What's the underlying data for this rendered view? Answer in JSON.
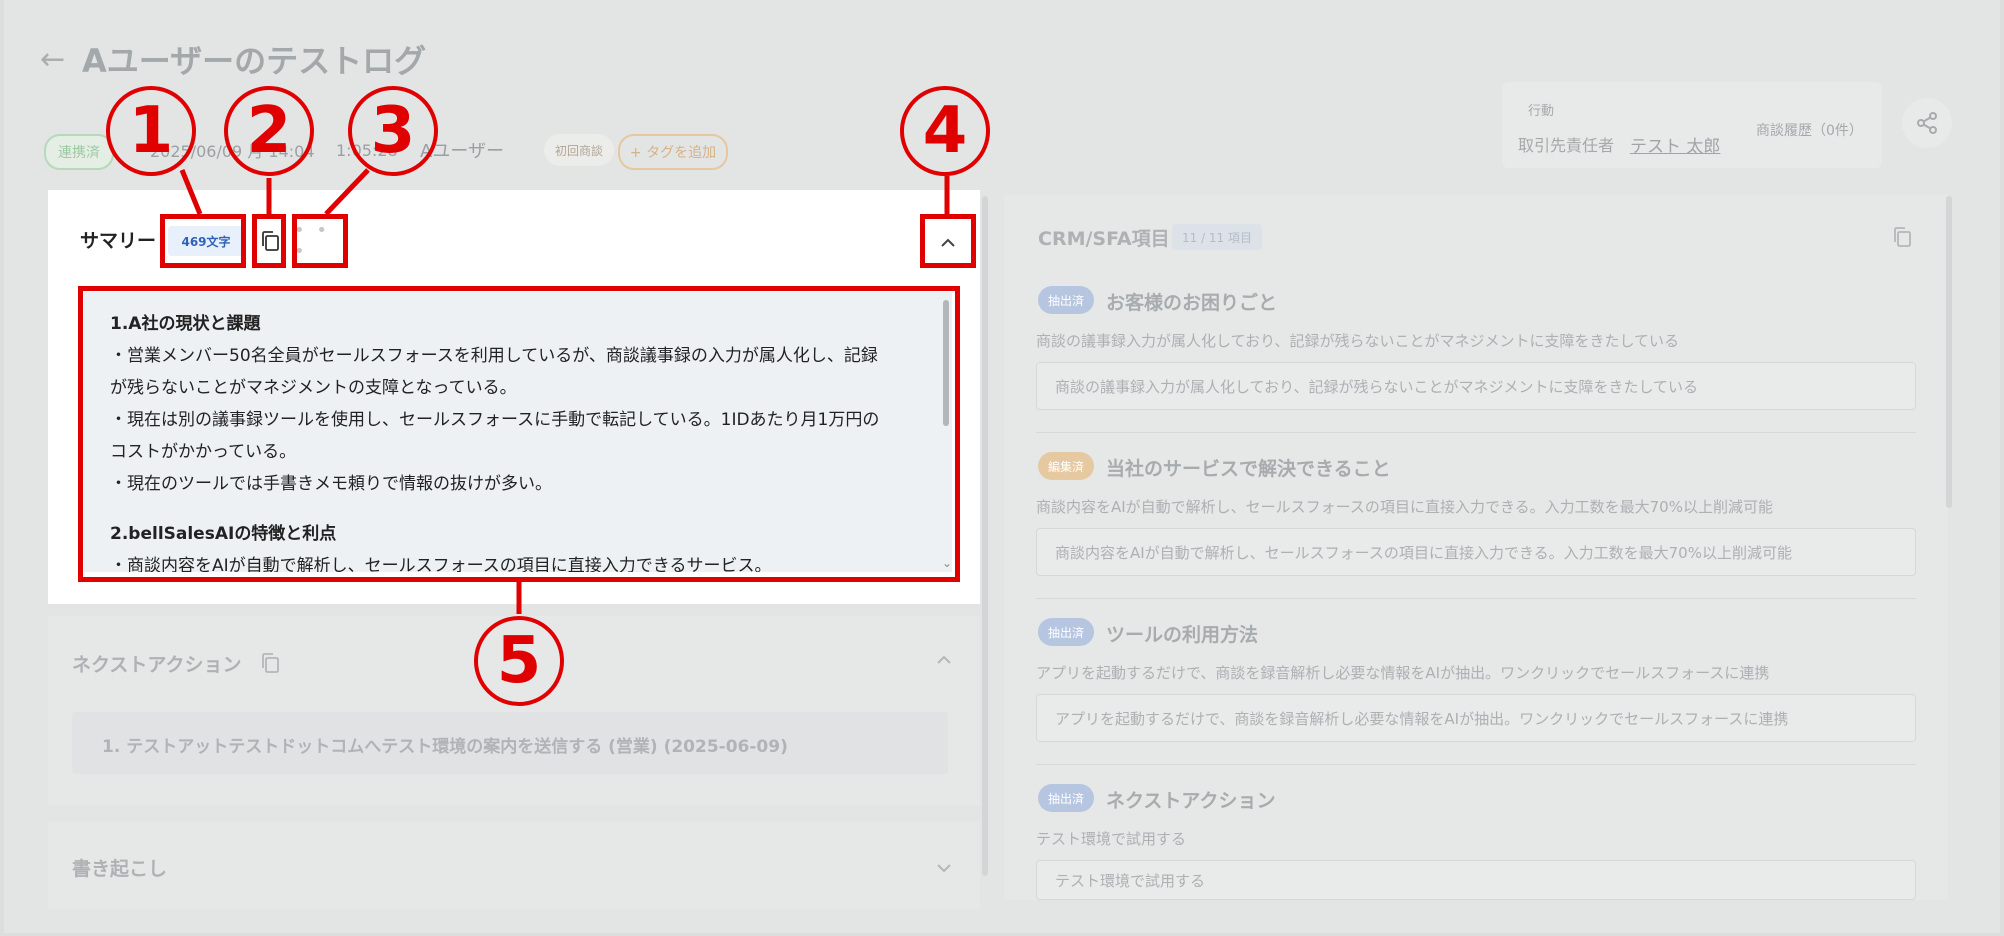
{
  "header": {
    "title": "Aユーザーのテストログ",
    "status_pill": "連携済",
    "date_text": "2025/06/09 月 14:04",
    "duration_text": "1:05:28",
    "user_text": "Aユーザー",
    "meeting_type": "初回商談",
    "add_tag_label": "+ タグを追加",
    "action_label": "行動",
    "responsible_label": "取引先責任者",
    "responsible_name": "テスト 太郎",
    "history_label": "商談履歴（0件）"
  },
  "summary": {
    "title": "サマリー",
    "char_count": "469文字",
    "more_glyph": "• • •",
    "collapse_glyph": "^",
    "sections": [
      {
        "heading": "1.A社の現状と課題",
        "lines": [
          "・営業メンバー50名全員がセールスフォースを利用しているが、商談議事録の入力が属人化し、記録",
          "が残らないことがマネジメントの支障となっている。",
          "・現在は別の議事録ツールを使用し、セールスフォースに手動で転記している。1IDあたり月1万円の",
          "コストがかかっている。",
          "・現在のツールでは手書きメモ頼りで情報の抜けが多い。"
        ]
      },
      {
        "heading": "2.bellSalesAIの特徴と利点",
        "lines": [
          "・商談内容をAIが自動で解析し、セールスフォースの項目に直接入力できるサービス。"
        ]
      }
    ]
  },
  "next_action": {
    "title": "ネクストアクション",
    "item": "1. テストアットテストドットコムへテスト環境の案内を送信する (営業) (2025-06-09)"
  },
  "transcript": {
    "title": "書き起こし"
  },
  "crm": {
    "title": "CRM/SFA項目",
    "count_badge": "11 / 11 項目",
    "fields": [
      {
        "tag": "抽出済",
        "tag_color": "#b6c6e0",
        "title": "お客様のお困りごと",
        "desc": "商談の議事録入力が属人化しており、記録が残らないことがマネジメントに支障をきたしている",
        "value": "商談の議事録入力が属人化しており、記録が残らないことがマネジメントに支障をきたしている"
      },
      {
        "tag": "編集済",
        "tag_color": "#e6c9a0",
        "title": "当社のサービスで解決できること",
        "desc": "商談内容をAIが自動で解析し、セールスフォースの項目に直接入力できる。入力工数を最大70%以上削減可能",
        "value": "商談内容をAIが自動で解析し、セールスフォースの項目に直接入力できる。入力工数を最大70%以上削減可能"
      },
      {
        "tag": "抽出済",
        "tag_color": "#b6c6e0",
        "title": "ツールの利用方法",
        "desc": "アプリを起動するだけで、商談を録音解析し必要な情報をAIが抽出。ワンクリックでセールスフォースに連携",
        "value": "アプリを起動するだけで、商談を録音解析し必要な情報をAIが抽出。ワンクリックでセールスフォースに連携"
      },
      {
        "tag": "抽出済",
        "tag_color": "#b6c6e0",
        "title": "ネクストアクション",
        "desc": "テスト環境で試用する",
        "value": "テスト環境で試用する"
      }
    ]
  },
  "annotations": {
    "n1": "1",
    "n2": "2",
    "n3": "3",
    "n4": "4",
    "n5": "5"
  },
  "colors": {
    "annotation_red": "#e00000",
    "badge_blue": "#2f62b8"
  }
}
